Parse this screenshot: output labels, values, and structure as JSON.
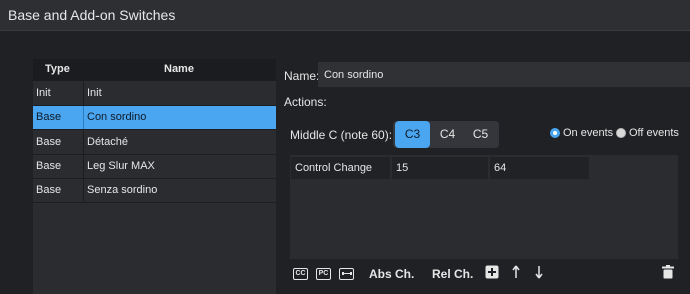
{
  "window": {
    "title": "Base and Add-on Switches"
  },
  "switch_table": {
    "headers": {
      "type": "Type",
      "name": "Name"
    },
    "rows": [
      {
        "type": "Init",
        "name": "Init"
      },
      {
        "type": "Base",
        "name": "Con sordino"
      },
      {
        "type": "Base",
        "name": "Détaché"
      },
      {
        "type": "Base",
        "name": "Leg Slur MAX"
      },
      {
        "type": "Base",
        "name": "Senza sordino"
      }
    ],
    "selected_index": 1
  },
  "detail": {
    "name_label": "Name:",
    "name_value": "Con sordino",
    "actions_label": "Actions:",
    "middle_c_label": "Middle C (note 60):",
    "middle_c_options": [
      "C3",
      "C4",
      "C5"
    ],
    "middle_c_selected": "C3",
    "radio_on_events": "On events",
    "radio_off_events": "Off events",
    "radio_selected": "On events"
  },
  "events_table": {
    "rows": [
      {
        "type": "Control Change",
        "value1": "15",
        "value2": "64"
      }
    ]
  },
  "toolbar": {
    "cc_icon": "CC",
    "pc_icon": "PC",
    "abs_ch_label": "Abs Ch.",
    "rel_ch_label": "Rel Ch.",
    "icons": [
      "cc-icon",
      "pc-icon",
      "sysex-icon",
      "add-icon",
      "move-up-icon",
      "move-down-icon",
      "trash-icon"
    ]
  },
  "colors": {
    "accent": "#4aa6f1",
    "background": "#1f2124",
    "panel": "#2a2c30"
  }
}
